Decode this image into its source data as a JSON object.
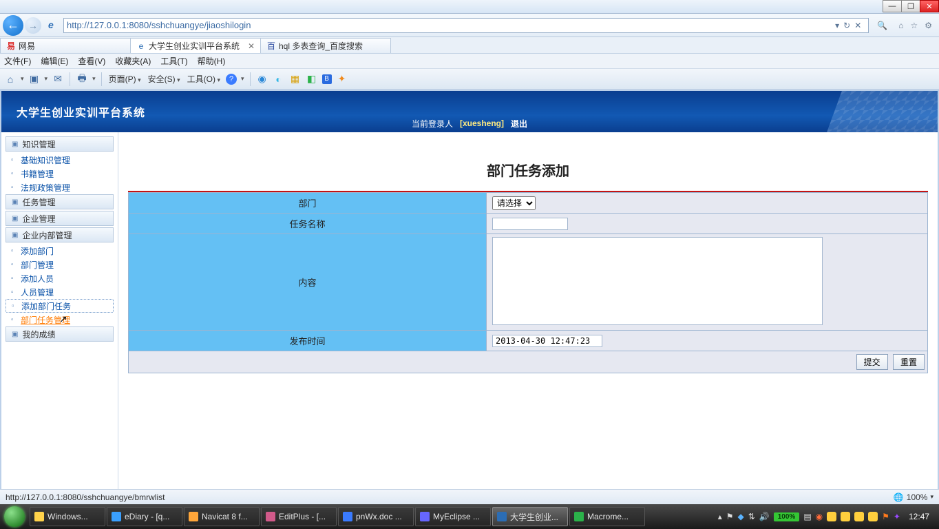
{
  "browser": {
    "url": "http://127.0.0.1:8080/sshchuangye/jiaoshilogin",
    "tabs": [
      {
        "label": "网易"
      },
      {
        "label": "大学生创业实训平台系统",
        "active": true
      },
      {
        "label": "hql 多表查询_百度搜索"
      }
    ],
    "menus": [
      "文件(F)",
      "编辑(E)",
      "查看(V)",
      "收藏夹(A)",
      "工具(T)",
      "帮助(H)"
    ],
    "toolbar_text": {
      "page": "页面(P)",
      "safety": "安全(S)",
      "tools": "工具(O)"
    },
    "status_url": "http://127.0.0.1:8080/sshchuangye/bmrwlist",
    "zoom": "100%"
  },
  "app": {
    "title": "大学生创业实训平台系统",
    "login_label": "当前登录人",
    "login_user": "[xuesheng]",
    "logout": "退出"
  },
  "sidebar": {
    "groups": [
      {
        "head": "知识管理",
        "items": [
          "基础知识管理",
          "书籍管理",
          "法规政策管理"
        ]
      },
      {
        "head": "任务管理",
        "items": []
      },
      {
        "head": "企业管理",
        "items": []
      },
      {
        "head": "企业内部管理",
        "items": [
          "添加部门",
          "部门管理",
          "添加人员",
          "人员管理",
          "添加部门任务",
          "部门任务管理"
        ]
      },
      {
        "head": "我的成绩",
        "items": []
      }
    ],
    "active": "部门任务管理",
    "dotted": "添加部门任务"
  },
  "form": {
    "title": "部门任务添加",
    "labels": {
      "dept": "部门",
      "task_name": "任务名称",
      "content": "内容",
      "publish": "发布时间"
    },
    "dept_placeholder": "请选择",
    "task_name_value": "",
    "content_value": "",
    "publish_value": "2013-04-30 12:47:23",
    "submit": "提交",
    "reset": "重置"
  },
  "taskbar": {
    "items": [
      {
        "label": "Windows...",
        "color": "#ffd24a"
      },
      {
        "label": "eDiary - [q...",
        "color": "#3aa0ff"
      },
      {
        "label": "Navicat 8 f...",
        "color": "#ffa63a"
      },
      {
        "label": "EditPlus - [...",
        "color": "#d15a8a"
      },
      {
        "label": "pnWx.doc ...",
        "color": "#3a7bff"
      },
      {
        "label": "MyEclipse ...",
        "color": "#6666ff"
      },
      {
        "label": "大学生创业...",
        "color": "#2b6db5",
        "active": true
      },
      {
        "label": "Macrome...",
        "color": "#2bb24a"
      }
    ],
    "battery": "100%",
    "clock": "12:47"
  }
}
